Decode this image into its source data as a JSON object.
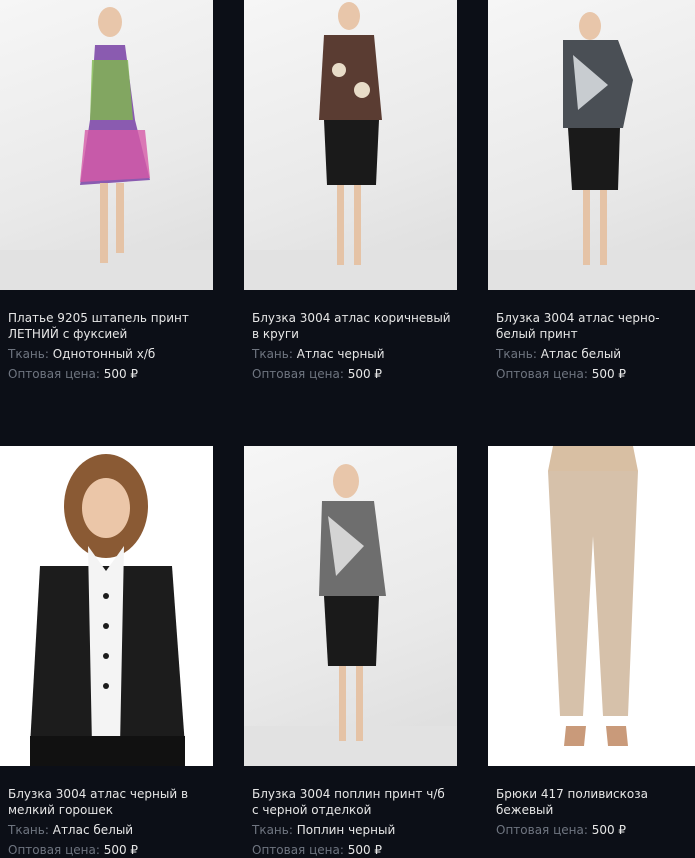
{
  "products": [
    {
      "title": "Платье 9205 штапель принт ЛЕТНИЙ с фуксией",
      "fabric_label": "Ткань:",
      "fabric": "Однотонный х/б",
      "price_label": "Оптовая цена:",
      "price": "500 ₽"
    },
    {
      "title": "Блузка 3004 атлас коричневый в круги",
      "fabric_label": "Ткань:",
      "fabric": "Атлас черный",
      "price_label": "Оптовая цена:",
      "price": "500 ₽"
    },
    {
      "title": "Блузка 3004 атлас черно-белый принт",
      "fabric_label": "Ткань:",
      "fabric": "Атлас белый",
      "price_label": "Оптовая цена:",
      "price": "500 ₽"
    },
    {
      "title": "Блузка 3004 атлас черный в мелкий горошек",
      "fabric_label": "Ткань:",
      "fabric": "Атлас белый",
      "price_label": "Оптовая цена:",
      "price": "500 ₽"
    },
    {
      "title": "Блузка 3004 поплин принт ч/б с черной отделкой",
      "fabric_label": "Ткань:",
      "fabric": "Поплин черный",
      "price_label": "Оптовая цена:",
      "price": "500 ₽"
    },
    {
      "title": "Брюки 417 поливискоза бежевый",
      "fabric_label": "",
      "fabric": "",
      "price_label": "Оптовая цена:",
      "price": "500 ₽"
    }
  ]
}
